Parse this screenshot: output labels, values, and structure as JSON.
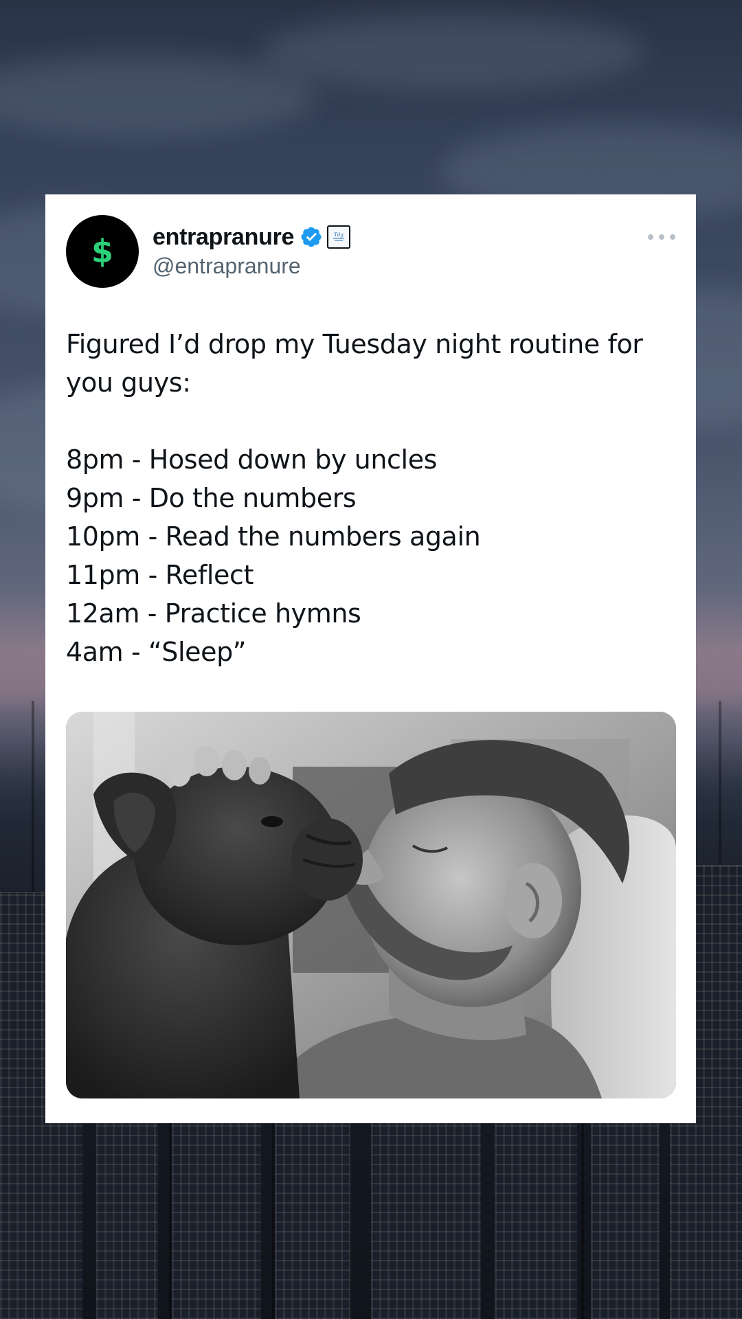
{
  "tweet": {
    "display_name": "entrapranure",
    "handle": "@entrapranure",
    "avatar_symbol": "$",
    "affiliate_badge_text": "Trading Alerts",
    "intro": "Figured I’d drop my Tuesday night routine for you guys:",
    "schedule": [
      "8pm - Hosed down by uncles",
      "9pm - Do the numbers",
      "10pm - Read the numbers again",
      "11pm - Reflect",
      "12am - Practice hymns",
      "4am - “Sleep”"
    ]
  },
  "icons": {
    "verified": "verified-badge-icon",
    "affiliate": "affiliate-badge-icon",
    "more": "more-options-icon"
  },
  "colors": {
    "card_bg": "#ffffff",
    "text_primary": "#0f1419",
    "text_secondary": "#536471",
    "verified_blue": "#1d9bf0",
    "avatar_bg": "#000000",
    "avatar_symbol": "#2ad179"
  }
}
